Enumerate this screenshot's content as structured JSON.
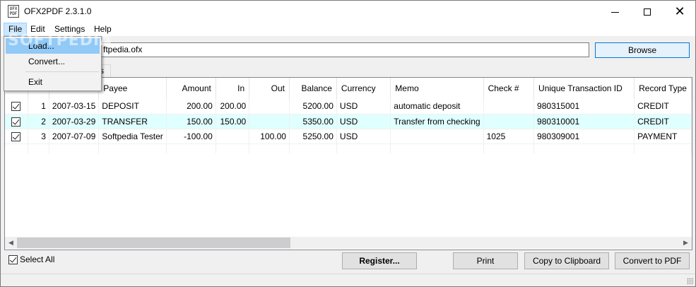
{
  "window": {
    "title": "OFX2PDF 2.3.1.0",
    "icon_line1": "OFX",
    "icon_line2": "PDF"
  },
  "menu": {
    "file": "File",
    "edit": "Edit",
    "settings": "Settings",
    "help": "Help"
  },
  "file_menu": {
    "load": "Load...",
    "convert": "Convert...",
    "exit": "Exit"
  },
  "watermark": "SOFTPEDIA",
  "path": {
    "value": "ftpedia.ofx"
  },
  "browse_label": "Browse",
  "tab_fragment": "s",
  "table": {
    "columns": [
      "Payee",
      "Amount",
      "In",
      "Out",
      "Balance",
      "Currency",
      "Memo",
      "Check #",
      "Unique Transaction ID",
      "Record Type"
    ],
    "rows": [
      {
        "num": "1",
        "date": "2007-03-15",
        "payee": "DEPOSIT",
        "amount": "200.00",
        "in": "200.00",
        "out": "",
        "balance": "5200.00",
        "currency": "USD",
        "memo": "automatic deposit",
        "check": "",
        "uid": "980315001",
        "type": "CREDIT"
      },
      {
        "num": "2",
        "date": "2007-03-29",
        "payee": "TRANSFER",
        "amount": "150.00",
        "in": "150.00",
        "out": "",
        "balance": "5350.00",
        "currency": "USD",
        "memo": "Transfer from checking",
        "check": "",
        "uid": "980310001",
        "type": "CREDIT"
      },
      {
        "num": "3",
        "date": "2007-07-09",
        "payee": "Softpedia Tester",
        "amount": "-100.00",
        "in": "",
        "out": "100.00",
        "balance": "5250.00",
        "currency": "USD",
        "memo": "",
        "check": "1025",
        "uid": "980309001",
        "type": "PAYMENT"
      }
    ]
  },
  "select_all_label": "Select All",
  "buttons": {
    "register": "Register...",
    "print": "Print",
    "copy": "Copy to Clipboard",
    "convert": "Convert to PDF"
  }
}
